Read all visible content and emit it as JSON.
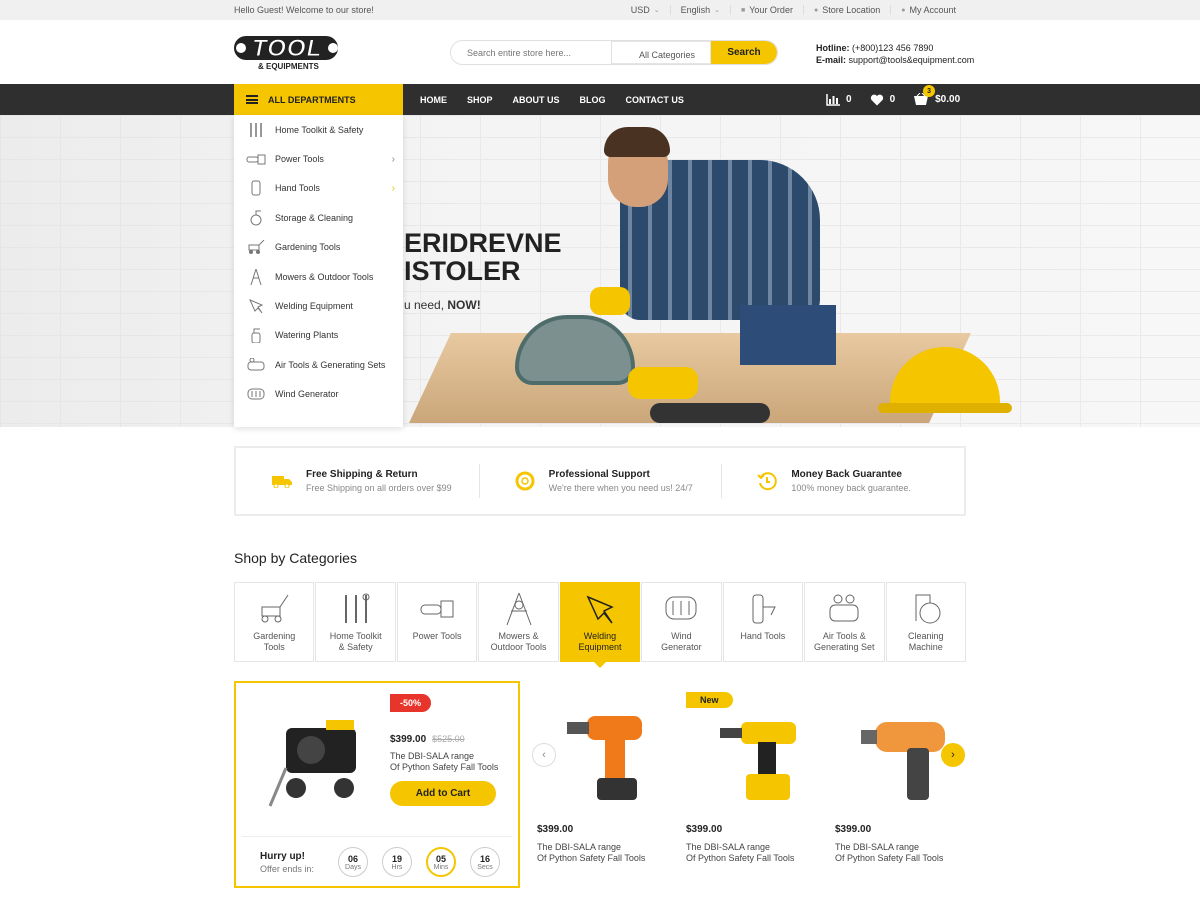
{
  "topbar": {
    "welcome": "Hello Guest! Welcome to our store!",
    "currency": "USD",
    "language": "English",
    "your_order": "Your Order",
    "store_location": "Store Location",
    "my_account": "My Account"
  },
  "logo": {
    "title": "TOOL",
    "subtitle": "& EQUIPMENTS"
  },
  "search": {
    "placeholder": "Search entire store here...",
    "category": "All Categories",
    "button": "Search"
  },
  "contact": {
    "hotline_label": "Hotline:",
    "hotline": "(+800)123 456 7890",
    "email_label": "E-mail:",
    "email": "support@tools&equipment.com"
  },
  "nav": {
    "all_departments": "ALL DEPARTMENTS",
    "menu": [
      "HOME",
      "SHOP",
      "ABOUT US",
      "BLOG",
      "CONTACT US"
    ],
    "compare_count": "0",
    "wishlist_count": "0",
    "cart_badge": "3",
    "cart_total": "$0.00"
  },
  "sidebar": {
    "items": [
      {
        "label": "Home Toolkit & Safety",
        "icon": "tools-icon"
      },
      {
        "label": "Power Tools",
        "icon": "chainsaw-icon",
        "arrow": "›"
      },
      {
        "label": "Hand Tools",
        "icon": "hand-tool-icon",
        "arrow": "›"
      },
      {
        "label": "Storage & Cleaning",
        "icon": "vacuum-icon"
      },
      {
        "label": "Gardening Tools",
        "icon": "lawnmower-icon"
      },
      {
        "label": "Mowers & Outdoor Tools",
        "icon": "mower-icon"
      },
      {
        "label": "Welding Equipment",
        "icon": "welding-icon"
      },
      {
        "label": "Watering Plants",
        "icon": "spray-icon"
      },
      {
        "label": "Air Tools & Generating Sets",
        "icon": "compressor-icon"
      },
      {
        "label": "Wind Generator",
        "icon": "generator-icon"
      }
    ]
  },
  "hero": {
    "line1": "ERIDREVNE",
    "line2": "ISTOLER",
    "sub_pre": "u need,",
    "sub_bold": "NOW!"
  },
  "features": [
    {
      "title": "Free Shipping & Return",
      "sub": "Free Shipping on all orders over $99",
      "icon": "truck-icon"
    },
    {
      "title": "Professional Support",
      "sub": "We're there when you need us! 24/7",
      "icon": "lifebuoy-icon"
    },
    {
      "title": "Money Back Guarantee",
      "sub": "100% money back guarantee.",
      "icon": "money-back-icon"
    }
  ],
  "shop_by_categories": "Shop by Categories",
  "categories": [
    {
      "l1": "Gardening",
      "l2": "Tools"
    },
    {
      "l1": "Home Toolkit",
      "l2": "& Safety"
    },
    {
      "l1": "Power Tools",
      "l2": ""
    },
    {
      "l1": "Mowers &",
      "l2": "Outdoor Tools"
    },
    {
      "l1": "Welding",
      "l2": "Equipment"
    },
    {
      "l1": "Wind",
      "l2": "Generator"
    },
    {
      "l1": "Hand Tools",
      "l2": ""
    },
    {
      "l1": "Air Tools &",
      "l2": "Generating Set"
    },
    {
      "l1": "Cleaning",
      "l2": "Machine"
    }
  ],
  "deal": {
    "discount": "-50%",
    "price": "$399.00",
    "old_price": "$525.00",
    "name1": "The DBI-SALA range",
    "name2": "Of Python Safety Fall Tools",
    "add_to_cart": "Add to Cart",
    "hurry": "Hurry up!",
    "ends": "Offer ends in:",
    "countdown": [
      {
        "n": "06",
        "u": "Days"
      },
      {
        "n": "19",
        "u": "Hrs"
      },
      {
        "n": "05",
        "u": "Mins"
      },
      {
        "n": "16",
        "u": "Secs"
      }
    ]
  },
  "products": [
    {
      "price": "$399.00",
      "name1": "The DBI-SALA range",
      "name2": "Of Python Safety Fall Tools",
      "tag": ""
    },
    {
      "price": "$399.00",
      "name1": "The DBI-SALA range",
      "name2": "Of Python Safety Fall Tools",
      "tag": "New"
    },
    {
      "price": "$399.00",
      "name1": "The DBI-SALA range",
      "name2": "Of Python Safety Fall Tools",
      "tag": ""
    }
  ],
  "colors": {
    "accent": "#f5c500",
    "dark": "#2f2f2f",
    "sale": "#e8352b"
  }
}
